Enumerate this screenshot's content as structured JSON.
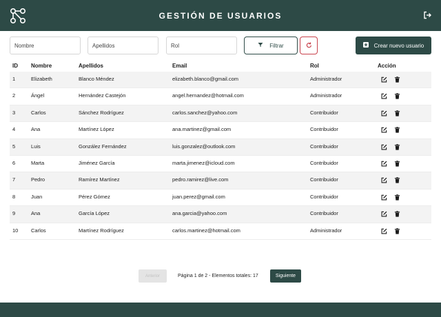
{
  "header": {
    "title": "GESTIÓN DE USUARIOS",
    "logo_icon": "network-nodes-icon",
    "logout_icon": "logout-icon"
  },
  "filters": {
    "nombre_placeholder": "Nombre",
    "apellidos_placeholder": "Apellidos",
    "rol_placeholder": "Rol",
    "filter_label": "Filtrar",
    "filter_icon": "funnel-icon",
    "reset_icon": "refresh-icon",
    "create_label": "Crear nuevo usuario",
    "create_icon": "plus-square-icon"
  },
  "table": {
    "headers": {
      "id": "ID",
      "nombre": "Nombre",
      "apellidos": "Apellidos",
      "email": "Email",
      "rol": "Rol",
      "accion": "Acción"
    },
    "rows": [
      {
        "id": "1",
        "nombre": "Elizabeth",
        "apellidos": "Blanco Méndez",
        "email": "elizabeth.blanco@gmail.com",
        "rol": "Administrador"
      },
      {
        "id": "2",
        "nombre": "Ángel",
        "apellidos": "Hernández Castejón",
        "email": "angel.hernandez@hotmail.com",
        "rol": "Administrador"
      },
      {
        "id": "3",
        "nombre": "Carlos",
        "apellidos": "Sánchez Rodríguez",
        "email": "carlos.sanchez@yahoo.com",
        "rol": "Contribuidor"
      },
      {
        "id": "4",
        "nombre": "Ana",
        "apellidos": "Martínez López",
        "email": "ana.martinez@gmail.com",
        "rol": "Contribuidor"
      },
      {
        "id": "5",
        "nombre": "Luis",
        "apellidos": "González Fernández",
        "email": "luis.gonzalez@outlook.com",
        "rol": "Contribuidor"
      },
      {
        "id": "6",
        "nombre": "Marta",
        "apellidos": "Jiménez García",
        "email": "marta.jimenez@icloud.com",
        "rol": "Contribuidor"
      },
      {
        "id": "7",
        "nombre": "Pedro",
        "apellidos": "Ramírez Martínez",
        "email": "pedro.ramirez@live.com",
        "rol": "Contribuidor"
      },
      {
        "id": "8",
        "nombre": "Juan",
        "apellidos": "Pérez Gómez",
        "email": "juan.perez@gmail.com",
        "rol": "Contribuidor"
      },
      {
        "id": "9",
        "nombre": "Ana",
        "apellidos": "García López",
        "email": "ana.garcia@yahoo.com",
        "rol": "Contribuidor"
      },
      {
        "id": "10",
        "nombre": "Carlos",
        "apellidos": "Martínez Rodríguez",
        "email": "carlos.martinez@hotmail.com",
        "rol": "Administrador"
      }
    ],
    "row_action_icons": [
      "edit-icon",
      "trash-icon"
    ]
  },
  "pagination": {
    "prev_label": "Anterior",
    "info": "Página 1 de 2 - Elementos totales: 17",
    "next_label": "Siguiente"
  },
  "colors": {
    "primary": "#2d4a46",
    "danger": "#c8414b",
    "row_alt": "#f3f3f3"
  }
}
